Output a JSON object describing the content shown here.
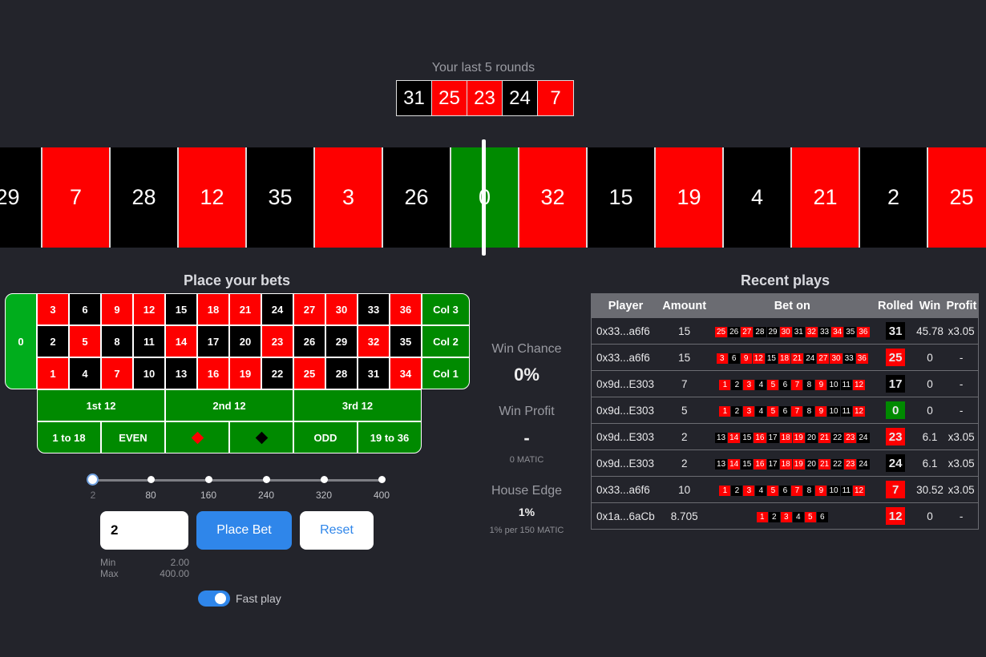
{
  "colors": {
    "red": "#fe0000",
    "black": "#000000",
    "green": "#008a00",
    "accent": "#2f86ea",
    "background": "#23242b"
  },
  "last_rounds": {
    "title": "Your last 5 rounds",
    "values": [
      {
        "n": "31",
        "c": "black"
      },
      {
        "n": "25",
        "c": "red"
      },
      {
        "n": "23",
        "c": "red"
      },
      {
        "n": "24",
        "c": "black"
      },
      {
        "n": "7",
        "c": "red"
      }
    ]
  },
  "strip": [
    {
      "n": "29",
      "c": "black"
    },
    {
      "n": "7",
      "c": "red"
    },
    {
      "n": "28",
      "c": "black"
    },
    {
      "n": "12",
      "c": "red"
    },
    {
      "n": "35",
      "c": "black"
    },
    {
      "n": "3",
      "c": "red"
    },
    {
      "n": "26",
      "c": "black"
    },
    {
      "n": "0",
      "c": "green"
    },
    {
      "n": "32",
      "c": "red"
    },
    {
      "n": "15",
      "c": "black"
    },
    {
      "n": "19",
      "c": "red"
    },
    {
      "n": "4",
      "c": "black"
    },
    {
      "n": "21",
      "c": "red"
    },
    {
      "n": "2",
      "c": "black"
    },
    {
      "n": "25",
      "c": "red"
    }
  ],
  "board": {
    "title": "Place your bets",
    "zero": "0",
    "rows": [
      [
        {
          "n": "3",
          "c": "red"
        },
        {
          "n": "6",
          "c": "black"
        },
        {
          "n": "9",
          "c": "red"
        },
        {
          "n": "12",
          "c": "red"
        },
        {
          "n": "15",
          "c": "black"
        },
        {
          "n": "18",
          "c": "red"
        },
        {
          "n": "21",
          "c": "red"
        },
        {
          "n": "24",
          "c": "black"
        },
        {
          "n": "27",
          "c": "red"
        },
        {
          "n": "30",
          "c": "red"
        },
        {
          "n": "33",
          "c": "black"
        },
        {
          "n": "36",
          "c": "red"
        }
      ],
      [
        {
          "n": "2",
          "c": "black"
        },
        {
          "n": "5",
          "c": "red"
        },
        {
          "n": "8",
          "c": "black"
        },
        {
          "n": "11",
          "c": "black"
        },
        {
          "n": "14",
          "c": "red"
        },
        {
          "n": "17",
          "c": "black"
        },
        {
          "n": "20",
          "c": "black"
        },
        {
          "n": "23",
          "c": "red"
        },
        {
          "n": "26",
          "c": "black"
        },
        {
          "n": "29",
          "c": "black"
        },
        {
          "n": "32",
          "c": "red"
        },
        {
          "n": "35",
          "c": "black"
        }
      ],
      [
        {
          "n": "1",
          "c": "red"
        },
        {
          "n": "4",
          "c": "black"
        },
        {
          "n": "7",
          "c": "red"
        },
        {
          "n": "10",
          "c": "black"
        },
        {
          "n": "13",
          "c": "black"
        },
        {
          "n": "16",
          "c": "red"
        },
        {
          "n": "19",
          "c": "red"
        },
        {
          "n": "22",
          "c": "black"
        },
        {
          "n": "25",
          "c": "red"
        },
        {
          "n": "28",
          "c": "black"
        },
        {
          "n": "31",
          "c": "black"
        },
        {
          "n": "34",
          "c": "red"
        }
      ]
    ],
    "columns": [
      "Col 3",
      "Col 2",
      "Col 1"
    ],
    "dozens": [
      "1st 12",
      "2nd 12",
      "3rd 12"
    ],
    "outside": {
      "low": "1 to 18",
      "even": "EVEN",
      "red_icon": "red-diamond-icon",
      "black_icon": "black-diamond-icon",
      "odd": "ODD",
      "high": "19 to 36"
    }
  },
  "slider": {
    "ticks": [
      "2",
      "80",
      "160",
      "240",
      "320",
      "400"
    ],
    "value": "2"
  },
  "bet": {
    "amount": "2",
    "place_label": "Place Bet",
    "reset_label": "Reset",
    "min_label": "Min",
    "min_value": "2.00",
    "max_label": "Max",
    "max_value": "400.00",
    "fast_play_label": "Fast play",
    "fast_play_on": true
  },
  "stats": {
    "win_chance_label": "Win Chance",
    "win_chance_value": "0%",
    "win_profit_label": "Win Profit",
    "win_profit_value": "-",
    "win_profit_sub": "0 MATIC",
    "house_edge_label": "House Edge",
    "house_edge_value": "1%",
    "house_edge_sub": "1% per 150 MATIC"
  },
  "recent": {
    "title": "Recent plays",
    "headers": [
      "Player",
      "Amount",
      "Bet on",
      "Rolled",
      "Win",
      "Profit"
    ],
    "rows": [
      {
        "player": "0x33...a6f6",
        "amount": "15",
        "bet_on": [
          {
            "n": "25",
            "c": "red"
          },
          {
            "n": "26",
            "c": "black"
          },
          {
            "n": "27",
            "c": "red"
          },
          {
            "n": "28",
            "c": "black"
          },
          {
            "n": "29",
            "c": "black"
          },
          {
            "n": "30",
            "c": "red"
          },
          {
            "n": "31",
            "c": "black"
          },
          {
            "n": "32",
            "c": "red"
          },
          {
            "n": "33",
            "c": "black"
          },
          {
            "n": "34",
            "c": "red"
          },
          {
            "n": "35",
            "c": "black"
          },
          {
            "n": "36",
            "c": "red"
          }
        ],
        "rolled": {
          "n": "31",
          "c": "black"
        },
        "win": "45.78",
        "profit": "x3.05"
      },
      {
        "player": "0x33...a6f6",
        "amount": "15",
        "bet_on": [
          {
            "n": "3",
            "c": "red"
          },
          {
            "n": "6",
            "c": "black"
          },
          {
            "n": "9",
            "c": "red"
          },
          {
            "n": "12",
            "c": "red"
          },
          {
            "n": "15",
            "c": "black"
          },
          {
            "n": "18",
            "c": "red"
          },
          {
            "n": "21",
            "c": "red"
          },
          {
            "n": "24",
            "c": "black"
          },
          {
            "n": "27",
            "c": "red"
          },
          {
            "n": "30",
            "c": "red"
          },
          {
            "n": "33",
            "c": "black"
          },
          {
            "n": "36",
            "c": "red"
          }
        ],
        "rolled": {
          "n": "25",
          "c": "red"
        },
        "win": "0",
        "profit": "-"
      },
      {
        "player": "0x9d...E303",
        "amount": "7",
        "bet_on": [
          {
            "n": "1",
            "c": "red"
          },
          {
            "n": "2",
            "c": "black"
          },
          {
            "n": "3",
            "c": "red"
          },
          {
            "n": "4",
            "c": "black"
          },
          {
            "n": "5",
            "c": "red"
          },
          {
            "n": "6",
            "c": "black"
          },
          {
            "n": "7",
            "c": "red"
          },
          {
            "n": "8",
            "c": "black"
          },
          {
            "n": "9",
            "c": "red"
          },
          {
            "n": "10",
            "c": "black"
          },
          {
            "n": "11",
            "c": "black"
          },
          {
            "n": "12",
            "c": "red"
          }
        ],
        "rolled": {
          "n": "17",
          "c": "black"
        },
        "win": "0",
        "profit": "-"
      },
      {
        "player": "0x9d...E303",
        "amount": "5",
        "bet_on": [
          {
            "n": "1",
            "c": "red"
          },
          {
            "n": "2",
            "c": "black"
          },
          {
            "n": "3",
            "c": "red"
          },
          {
            "n": "4",
            "c": "black"
          },
          {
            "n": "5",
            "c": "red"
          },
          {
            "n": "6",
            "c": "black"
          },
          {
            "n": "7",
            "c": "red"
          },
          {
            "n": "8",
            "c": "black"
          },
          {
            "n": "9",
            "c": "red"
          },
          {
            "n": "10",
            "c": "black"
          },
          {
            "n": "11",
            "c": "black"
          },
          {
            "n": "12",
            "c": "red"
          }
        ],
        "rolled": {
          "n": "0",
          "c": "green"
        },
        "win": "0",
        "profit": "-"
      },
      {
        "player": "0x9d...E303",
        "amount": "2",
        "bet_on": [
          {
            "n": "13",
            "c": "black"
          },
          {
            "n": "14",
            "c": "red"
          },
          {
            "n": "15",
            "c": "black"
          },
          {
            "n": "16",
            "c": "red"
          },
          {
            "n": "17",
            "c": "black"
          },
          {
            "n": "18",
            "c": "red"
          },
          {
            "n": "19",
            "c": "red"
          },
          {
            "n": "20",
            "c": "black"
          },
          {
            "n": "21",
            "c": "red"
          },
          {
            "n": "22",
            "c": "black"
          },
          {
            "n": "23",
            "c": "red"
          },
          {
            "n": "24",
            "c": "black"
          }
        ],
        "rolled": {
          "n": "23",
          "c": "red"
        },
        "win": "6.1",
        "profit": "x3.05"
      },
      {
        "player": "0x9d...E303",
        "amount": "2",
        "bet_on": [
          {
            "n": "13",
            "c": "black"
          },
          {
            "n": "14",
            "c": "red"
          },
          {
            "n": "15",
            "c": "black"
          },
          {
            "n": "16",
            "c": "red"
          },
          {
            "n": "17",
            "c": "black"
          },
          {
            "n": "18",
            "c": "red"
          },
          {
            "n": "19",
            "c": "red"
          },
          {
            "n": "20",
            "c": "black"
          },
          {
            "n": "21",
            "c": "red"
          },
          {
            "n": "22",
            "c": "black"
          },
          {
            "n": "23",
            "c": "red"
          },
          {
            "n": "24",
            "c": "black"
          }
        ],
        "rolled": {
          "n": "24",
          "c": "black"
        },
        "win": "6.1",
        "profit": "x3.05"
      },
      {
        "player": "0x33...a6f6",
        "amount": "10",
        "bet_on": [
          {
            "n": "1",
            "c": "red"
          },
          {
            "n": "2",
            "c": "black"
          },
          {
            "n": "3",
            "c": "red"
          },
          {
            "n": "4",
            "c": "black"
          },
          {
            "n": "5",
            "c": "red"
          },
          {
            "n": "6",
            "c": "black"
          },
          {
            "n": "7",
            "c": "red"
          },
          {
            "n": "8",
            "c": "black"
          },
          {
            "n": "9",
            "c": "red"
          },
          {
            "n": "10",
            "c": "black"
          },
          {
            "n": "11",
            "c": "black"
          },
          {
            "n": "12",
            "c": "red"
          }
        ],
        "rolled": {
          "n": "7",
          "c": "red"
        },
        "win": "30.52",
        "profit": "x3.05"
      },
      {
        "player": "0x1a...6aCb",
        "amount": "8.705",
        "bet_on": [
          {
            "n": "1",
            "c": "red"
          },
          {
            "n": "2",
            "c": "black"
          },
          {
            "n": "3",
            "c": "red"
          },
          {
            "n": "4",
            "c": "black"
          },
          {
            "n": "5",
            "c": "red"
          },
          {
            "n": "6",
            "c": "black"
          }
        ],
        "rolled": {
          "n": "12",
          "c": "red"
        },
        "win": "0",
        "profit": "-"
      }
    ]
  }
}
